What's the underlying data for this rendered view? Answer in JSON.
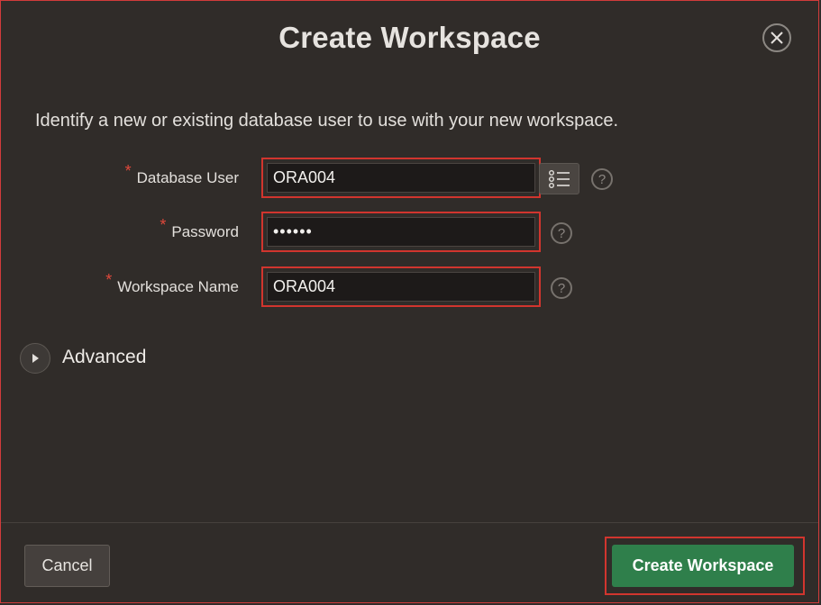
{
  "dialog": {
    "title": "Create Workspace",
    "intro": "Identify a new or existing database user to use with your new workspace."
  },
  "fields": {
    "database_user": {
      "label": "Database User",
      "value": "ORA004",
      "required_mark": "*",
      "help": "?"
    },
    "password": {
      "label": "Password",
      "value": "••••••",
      "required_mark": "*",
      "help": "?"
    },
    "workspace_name": {
      "label": "Workspace Name",
      "value": "ORA004",
      "required_mark": "*",
      "help": "?"
    }
  },
  "advanced": {
    "label": "Advanced"
  },
  "footer": {
    "cancel_label": "Cancel",
    "create_label": "Create Workspace"
  },
  "colors": {
    "background": "#302c29",
    "required": "#e0483b",
    "highlight_border": "#d1352e",
    "primary_button": "#2f7f4b"
  },
  "icons": {
    "close": "close-icon",
    "lov": "list-icon",
    "help": "help-icon",
    "expand": "play-triangle-icon"
  }
}
